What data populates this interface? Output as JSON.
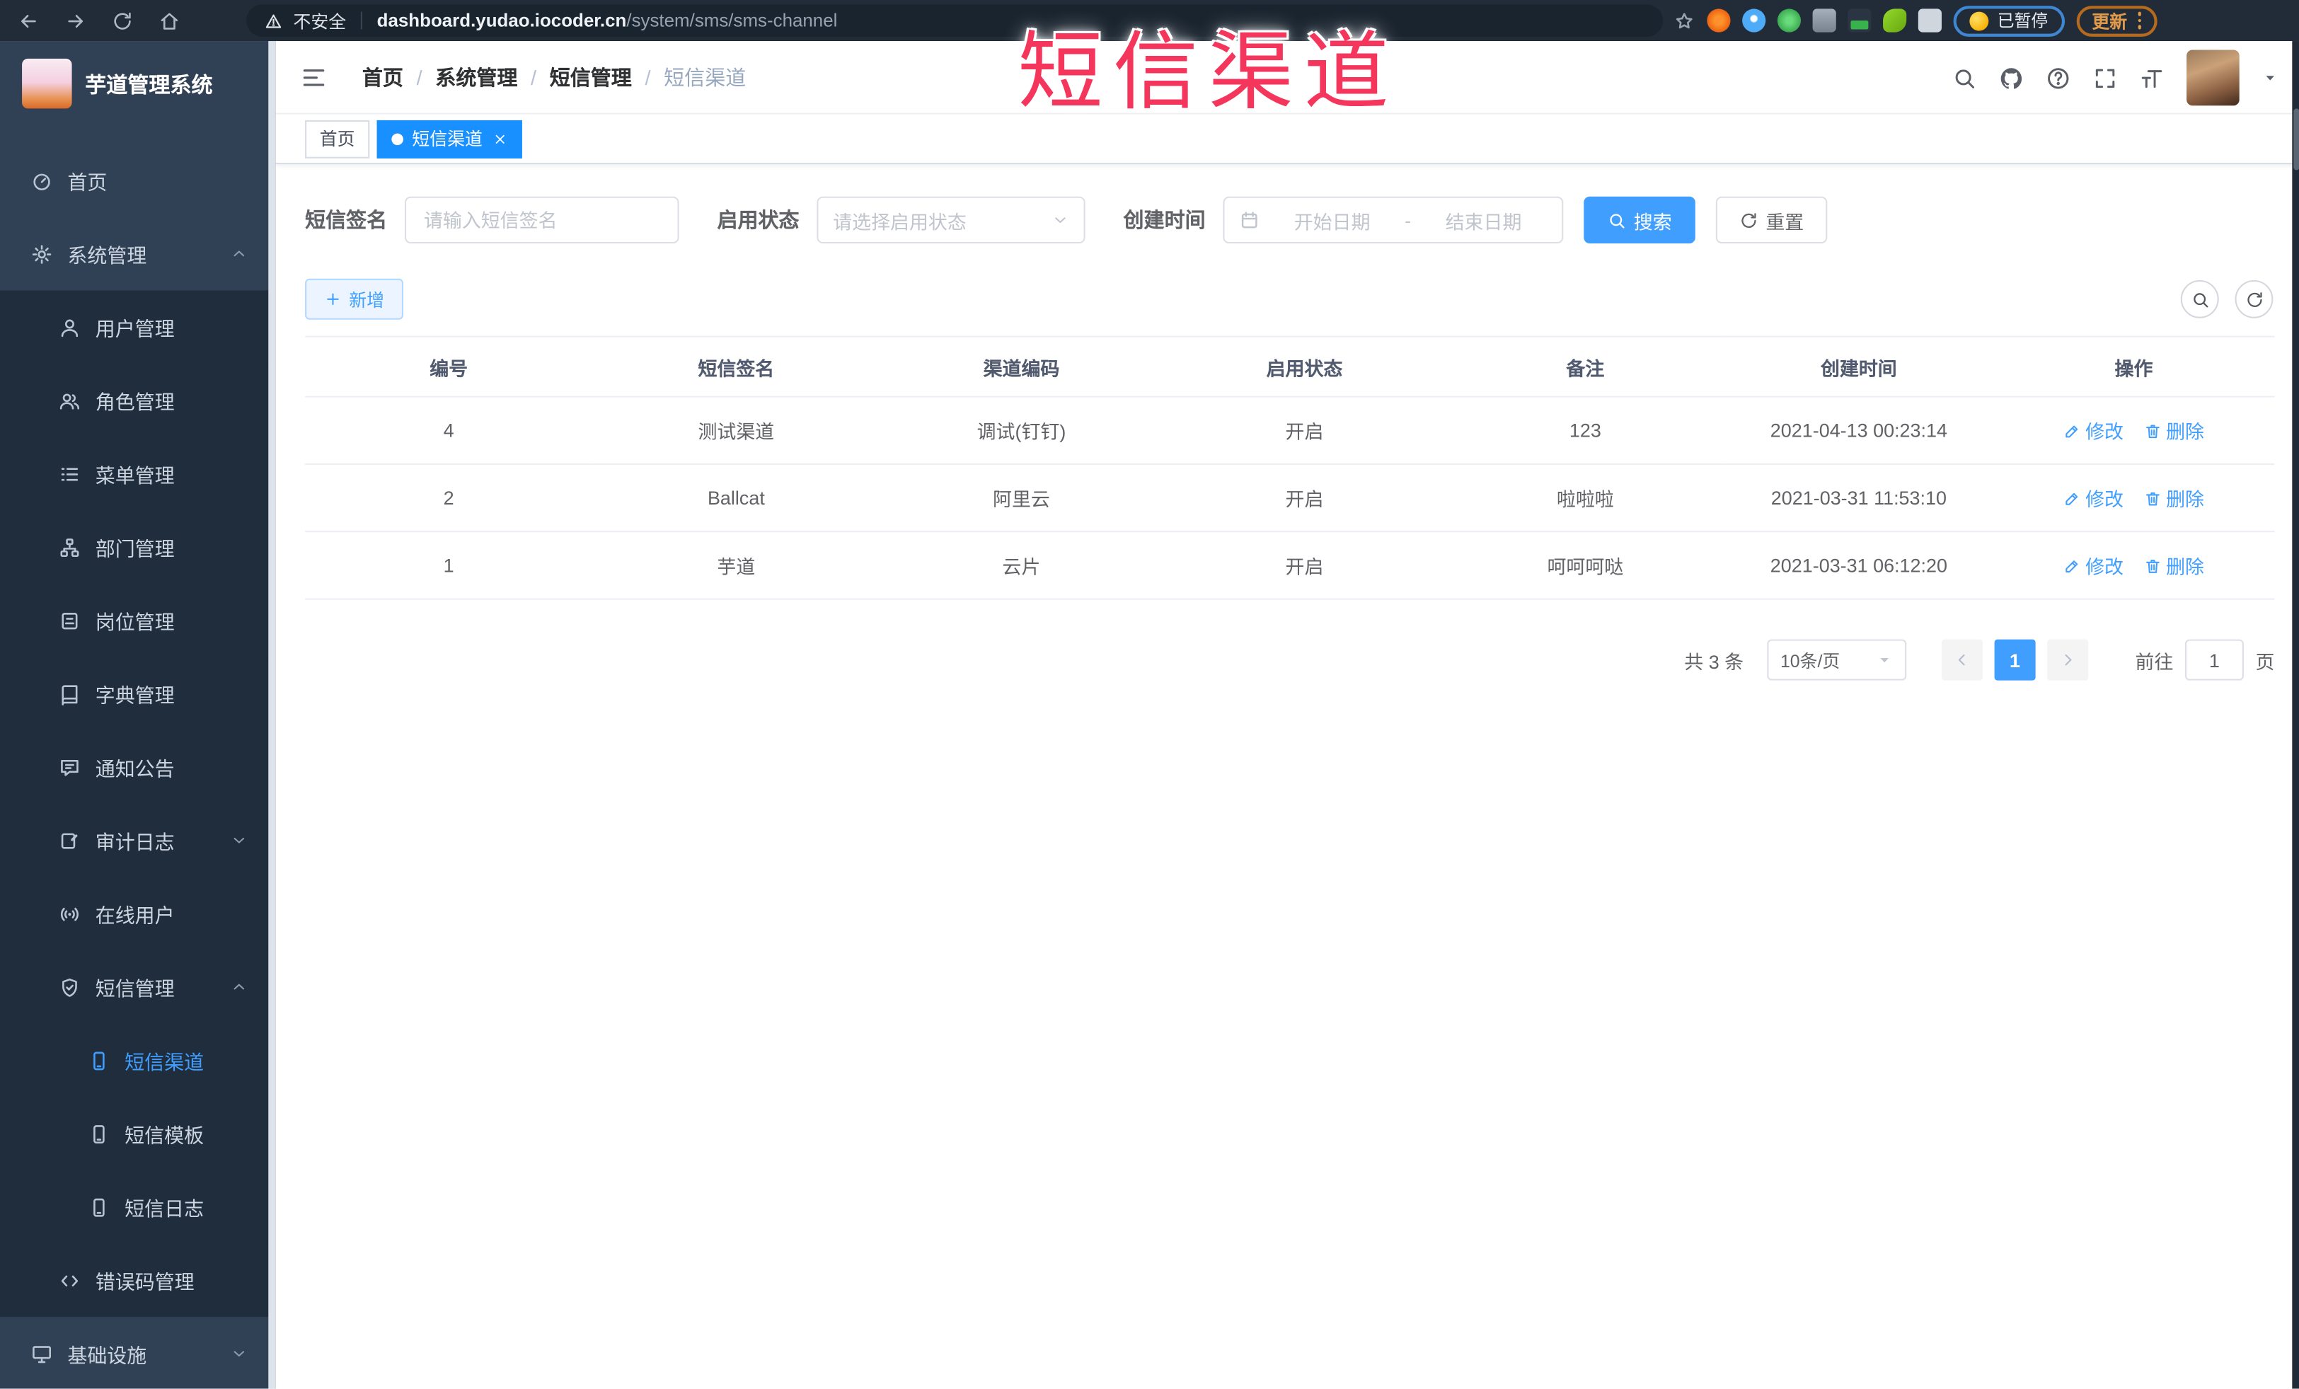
{
  "colors": {
    "accent": "#409eff",
    "active_tab": "#1890ff",
    "annotation": "#f5365c",
    "sidebar_bg": "#304156",
    "submenu_bg": "#1f2d3d"
  },
  "browser": {
    "nav_icons": [
      "back-icon",
      "forward-icon",
      "reload-icon",
      "home-icon"
    ],
    "security_warning": "不安全",
    "url_domain": "dashboard.yudao.iocoder.cn",
    "url_path": "/system/sms/sms-channel",
    "extension_icons": [
      "ext-orange",
      "ext-pin",
      "ext-check",
      "ext-grid",
      "ext-screen",
      "ext-leaf",
      "ext-puzzle"
    ],
    "paused_label": "已暂停",
    "update_label": "更新"
  },
  "annotation": {
    "text": "短信渠道"
  },
  "sidebar": {
    "title": "芋道管理系统",
    "items": [
      {
        "label": "首页",
        "icon": "dashboard-icon",
        "level": 1
      },
      {
        "label": "系统管理",
        "icon": "gear-icon",
        "level": 1,
        "chevron": "up"
      },
      {
        "label": "用户管理",
        "icon": "user-icon",
        "level": 2,
        "sub": true
      },
      {
        "label": "角色管理",
        "icon": "users-icon",
        "level": 2,
        "sub": true
      },
      {
        "label": "菜单管理",
        "icon": "menu-list-icon",
        "level": 2,
        "sub": true
      },
      {
        "label": "部门管理",
        "icon": "org-tree-icon",
        "level": 2,
        "sub": true
      },
      {
        "label": "岗位管理",
        "icon": "id-badge-icon",
        "level": 2,
        "sub": true
      },
      {
        "label": "字典管理",
        "icon": "book-icon",
        "level": 2,
        "sub": true
      },
      {
        "label": "通知公告",
        "icon": "announcement-icon",
        "level": 2,
        "sub": true
      },
      {
        "label": "审计日志",
        "icon": "audit-log-icon",
        "level": 2,
        "sub": true,
        "chevron": "down"
      },
      {
        "label": "在线用户",
        "icon": "online-users-icon",
        "level": 2,
        "sub": true
      },
      {
        "label": "短信管理",
        "icon": "sms-shield-icon",
        "level": 2,
        "sub": true,
        "chevron": "up"
      },
      {
        "label": "短信渠道",
        "icon": "phone-icon",
        "level": 3,
        "sub": true,
        "active": true
      },
      {
        "label": "短信模板",
        "icon": "phone-icon",
        "level": 3,
        "sub": true
      },
      {
        "label": "短信日志",
        "icon": "phone-icon",
        "level": 3,
        "sub": true
      },
      {
        "label": "错误码管理",
        "icon": "code-icon",
        "level": 2,
        "sub": true
      },
      {
        "label": "基础设施",
        "icon": "infrastructure-icon",
        "level": 1,
        "chevron": "down"
      }
    ]
  },
  "header": {
    "breadcrumb": [
      {
        "label": "首页"
      },
      {
        "label": "系统管理"
      },
      {
        "label": "短信管理"
      },
      {
        "label": "短信渠道",
        "current": true
      }
    ],
    "icons": [
      "search-icon",
      "github-icon",
      "question-icon",
      "fullscreen-icon",
      "font-size-icon"
    ]
  },
  "tabs": [
    {
      "label": "首页"
    },
    {
      "label": "短信渠道",
      "active": true,
      "closable": true
    }
  ],
  "filters": {
    "sign_label": "短信签名",
    "sign_placeholder": "请输入短信签名",
    "status_label": "启用状态",
    "status_placeholder": "请选择启用状态",
    "time_label": "创建时间",
    "start_placeholder": "开始日期",
    "range_separator": "-",
    "end_placeholder": "结束日期",
    "search_label": "搜索",
    "reset_label": "重置"
  },
  "toolbar": {
    "add_label": "新增"
  },
  "table": {
    "columns": [
      "编号",
      "短信签名",
      "渠道编码",
      "启用状态",
      "备注",
      "创建时间",
      "操作"
    ],
    "rows": [
      {
        "id": "4",
        "sign": "测试渠道",
        "code": "调试(钉钉)",
        "status": "开启",
        "remark": "123",
        "created": "2021-04-13 00:23:14"
      },
      {
        "id": "2",
        "sign": "Ballcat",
        "code": "阿里云",
        "status": "开启",
        "remark": "啦啦啦",
        "created": "2021-03-31 11:53:10"
      },
      {
        "id": "1",
        "sign": "芋道",
        "code": "云片",
        "status": "开启",
        "remark": "呵呵呵哒",
        "created": "2021-03-31 06:12:20"
      }
    ],
    "edit_label": "修改",
    "delete_label": "删除"
  },
  "pagination": {
    "total_text": "共 3 条",
    "page_size": "10条/页",
    "current_page": "1",
    "goto_label": "前往",
    "goto_value": "1",
    "unit_label": "页"
  }
}
